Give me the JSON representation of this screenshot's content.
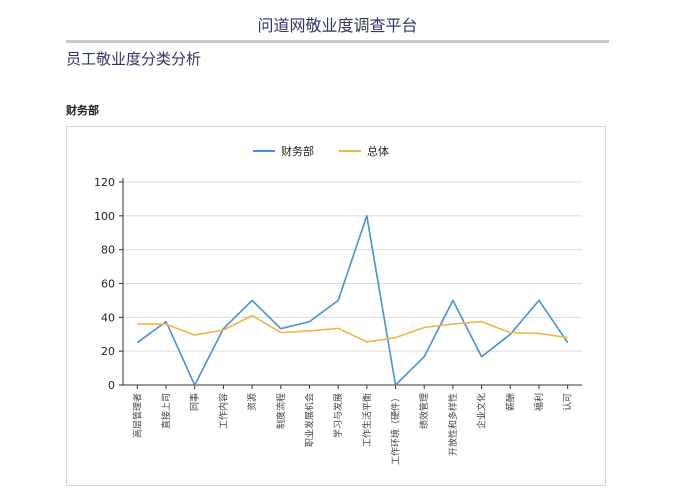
{
  "page": {
    "site_title": "问道网敬业度调查平台",
    "section_title": "员工敬业度分类分析",
    "department": "财务部"
  },
  "chart_data": {
    "type": "line",
    "title": "",
    "xlabel": "",
    "ylabel": "",
    "ylim": [
      0,
      120
    ],
    "yticks": [
      0,
      20,
      40,
      60,
      80,
      100,
      120
    ],
    "grid": true,
    "legend_position": "top-center",
    "categories": [
      "高层管理者",
      "直接上司",
      "同事",
      "工作内容",
      "资源",
      "制度流程",
      "职业发展机会",
      "学习与发展",
      "工作生活平衡",
      "工作环境（硬件）",
      "绩效管理",
      "开放性和多样性",
      "企业文化",
      "薪酬",
      "福利",
      "认可"
    ],
    "series": [
      {
        "name": "财务部",
        "color": "#4a8fd9",
        "values": [
          25,
          37.5,
          0,
          33.3,
          50,
          33.3,
          37.5,
          50,
          100,
          0,
          16.7,
          50,
          16.7,
          30,
          50,
          25
        ]
      },
      {
        "name": "总体",
        "color": "#f0b54a",
        "values": [
          36,
          36,
          29.5,
          32.5,
          41,
          31,
          32,
          33.5,
          25.5,
          28,
          34,
          36,
          37.5,
          31,
          30.5,
          28
        ]
      }
    ]
  }
}
